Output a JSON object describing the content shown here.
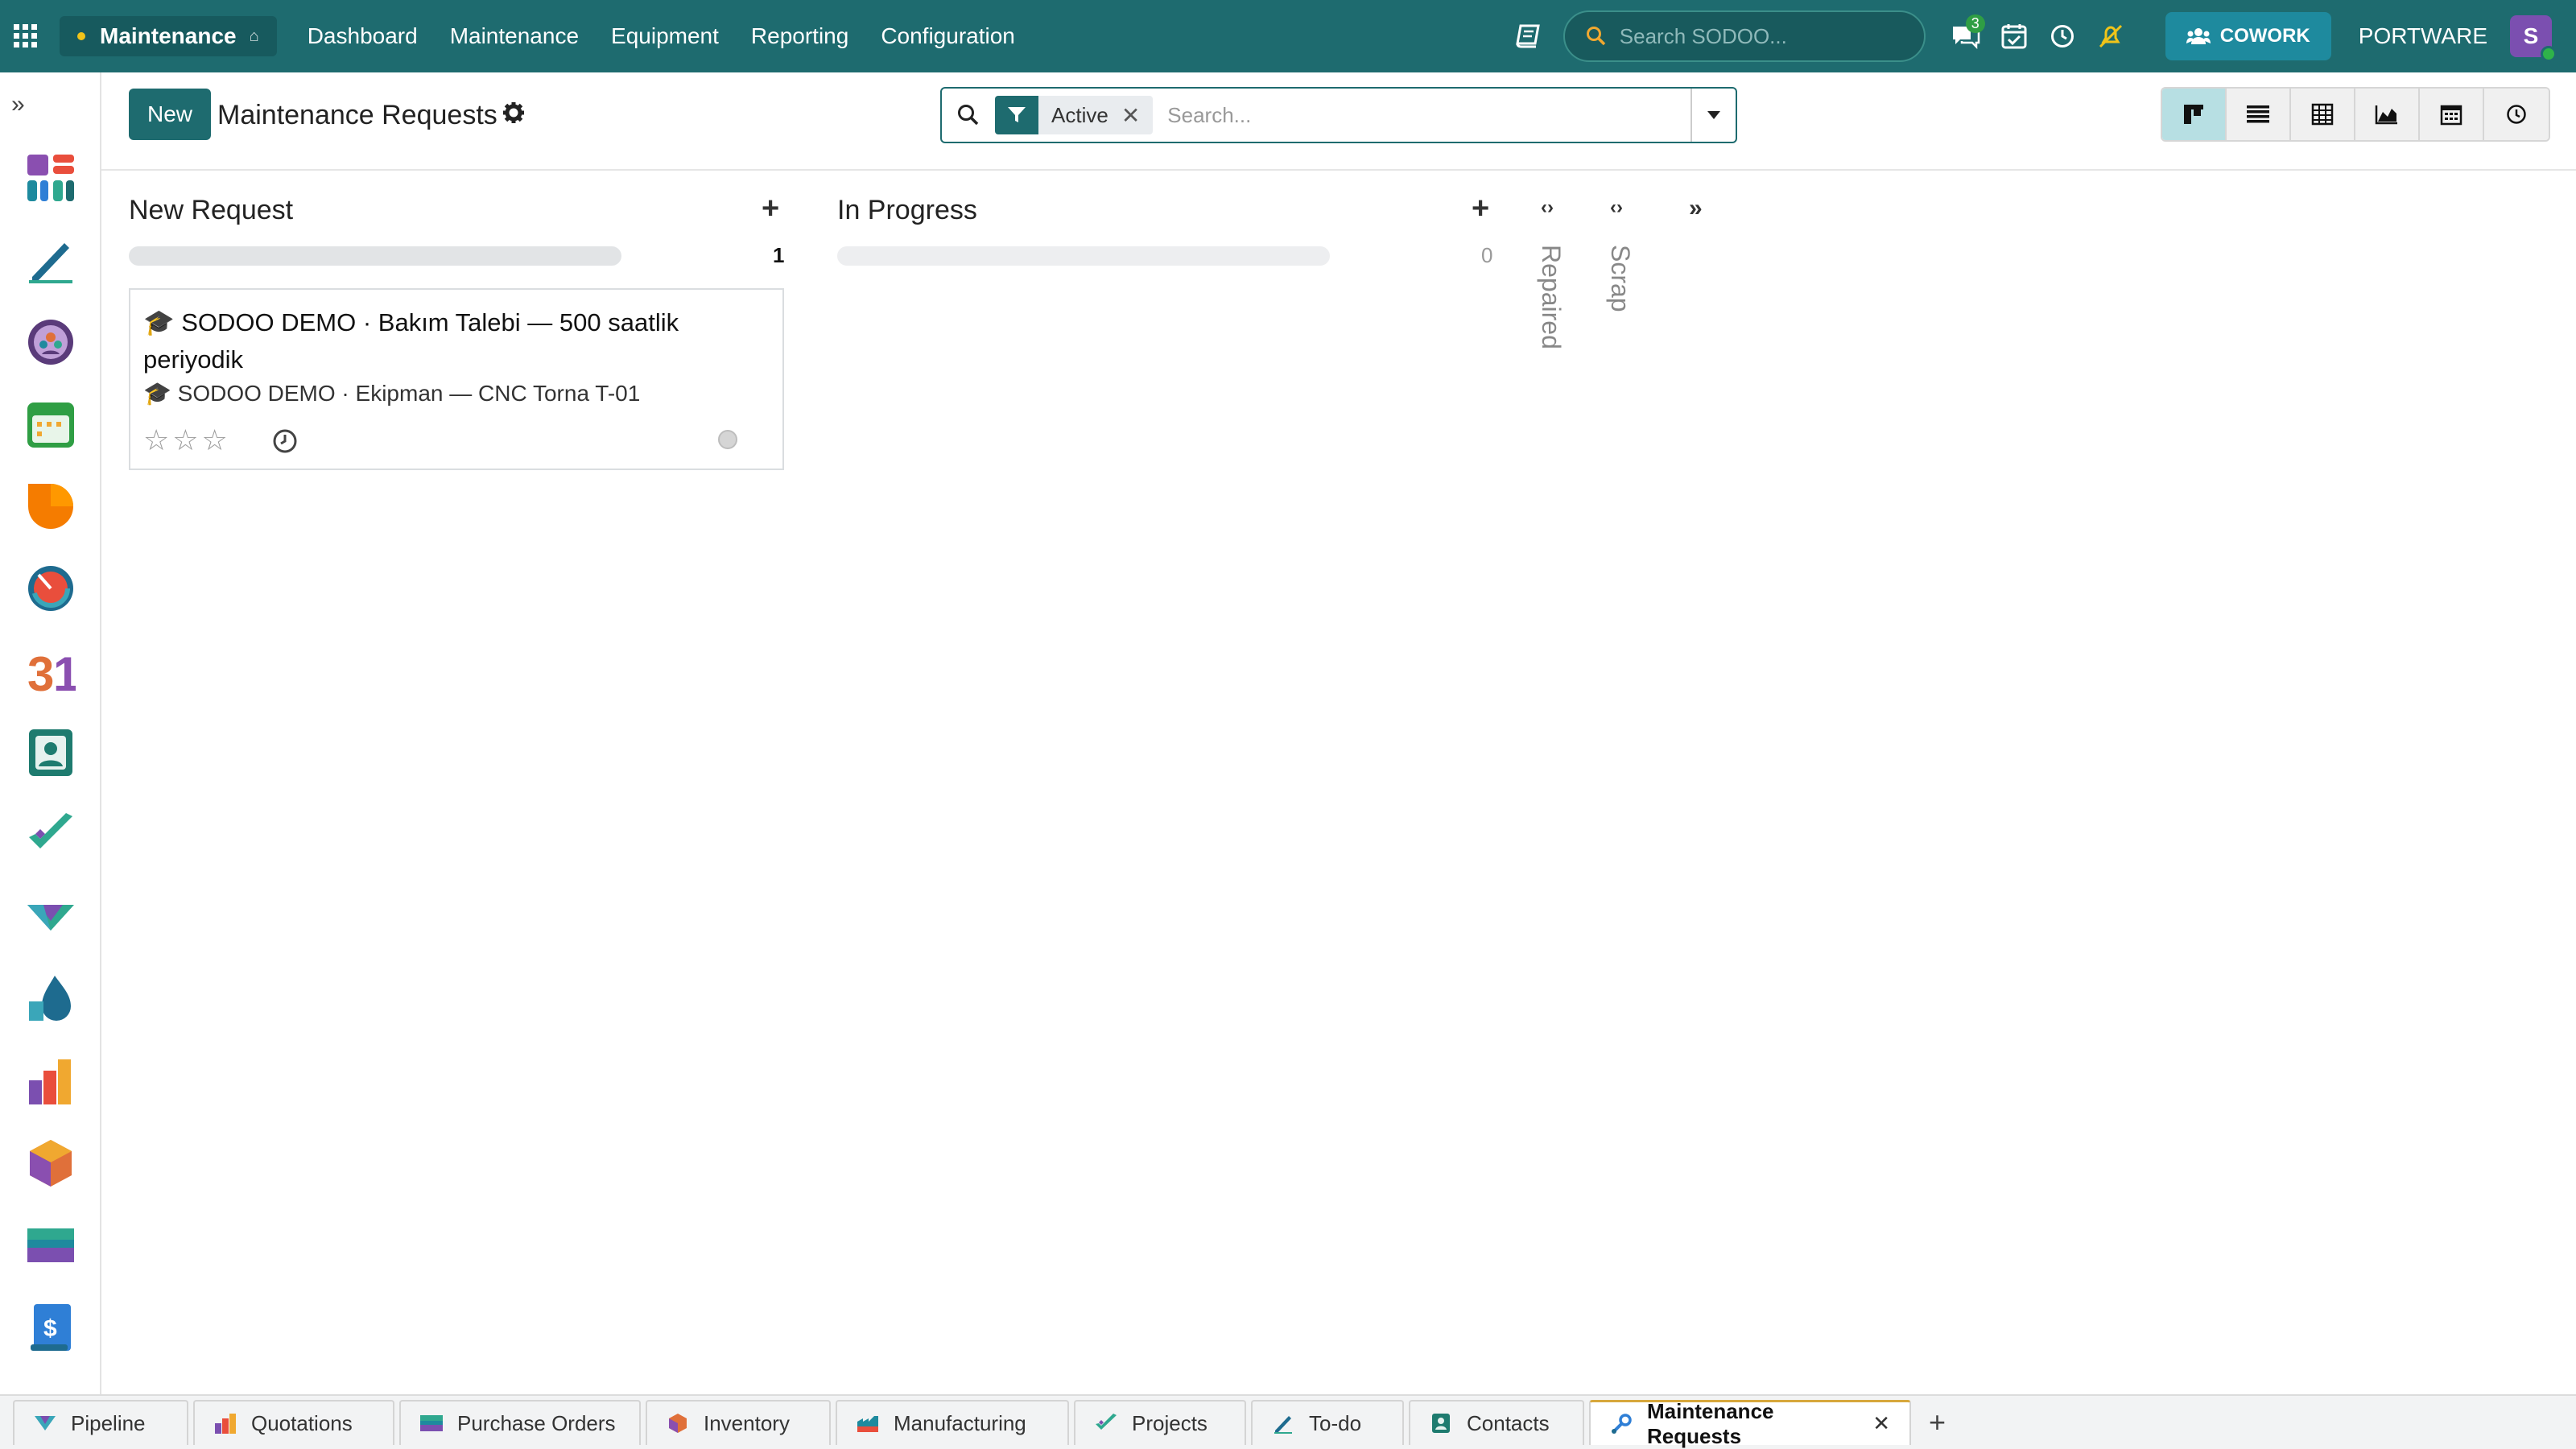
{
  "navbar": {
    "app_name": "Maintenance",
    "menu": [
      "Dashboard",
      "Maintenance",
      "Equipment",
      "Reporting",
      "Configuration"
    ],
    "search_placeholder": "Search SODOO...",
    "messages_badge": "3",
    "cowork_label": "COWORK",
    "company": "PORTWARE",
    "avatar_letter": "S"
  },
  "control": {
    "new_label": "New",
    "title": "Maintenance Requests",
    "facet_label": "Active",
    "search_placeholder": "Search..."
  },
  "kanban": {
    "columns": [
      {
        "title": "New Request",
        "count": "1"
      },
      {
        "title": "In Progress",
        "count": "0"
      }
    ],
    "folded": [
      "Repaired",
      "Scrap"
    ],
    "card": {
      "title": "🎓 SODOO DEMO · Bakım Talebi — 500 saatlik periyodik",
      "subtitle": "🎓 SODOO DEMO · Ekipman — CNC Torna T-01",
      "stars": "☆☆☆"
    }
  },
  "tabs": [
    {
      "label": "Pipeline",
      "icon": "pipeline-icon",
      "color": "#3aa6b9"
    },
    {
      "label": "Quotations",
      "icon": "quotations-icon",
      "color": "#e94e3c"
    },
    {
      "label": "Purchase Orders",
      "icon": "purchase-icon",
      "color": "#7b4fb0"
    },
    {
      "label": "Inventory",
      "icon": "inventory-icon",
      "color": "#e0703a"
    },
    {
      "label": "Manufacturing",
      "icon": "manufacturing-icon",
      "color": "#1e8a9e"
    },
    {
      "label": "Projects",
      "icon": "projects-icon",
      "color": "#2fa88f"
    },
    {
      "label": "To-do",
      "icon": "todo-icon",
      "color": "#1e6b8f"
    },
    {
      "label": "Contacts",
      "icon": "contacts-icon",
      "color": "#1e7b6f"
    },
    {
      "label": "Maintenance Requests",
      "icon": "maintenance-icon",
      "color": "#2f7fd6",
      "active": true
    }
  ],
  "colors": {
    "brand": "#1e6b6f",
    "active_view": "#b7dfe3"
  }
}
